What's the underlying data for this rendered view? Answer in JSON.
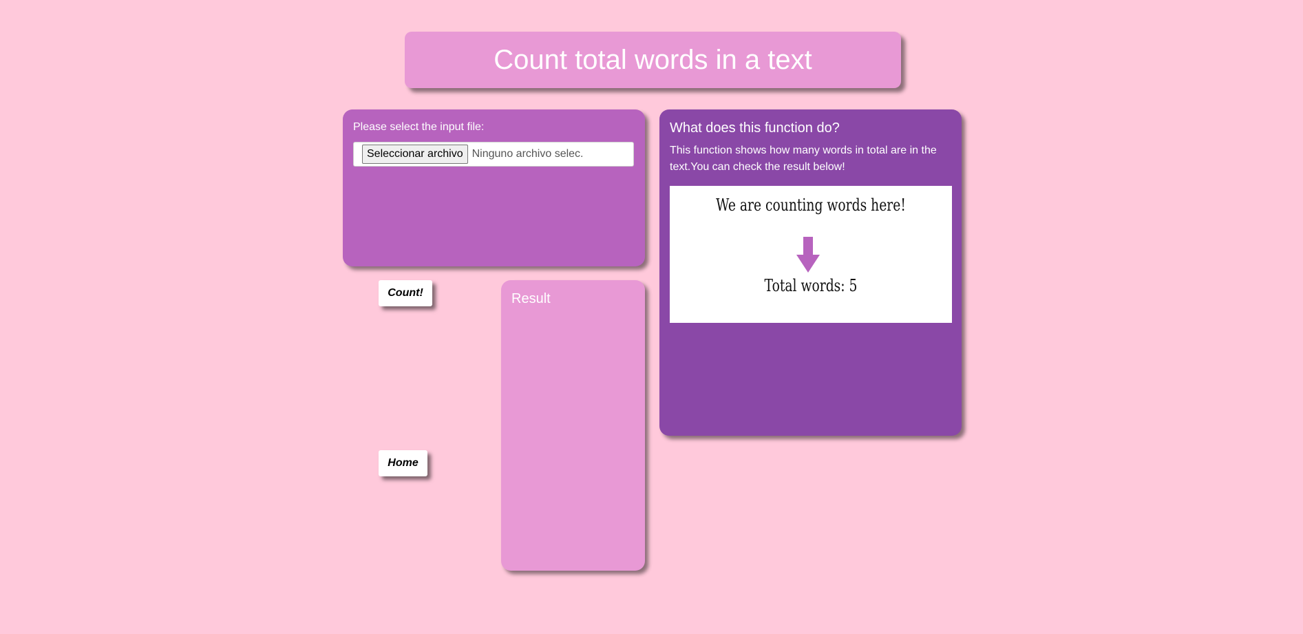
{
  "header": {
    "title": "Count total words in a text"
  },
  "input_panel": {
    "label": "Please select the input file:",
    "file_button_label": "Seleccionar archivo",
    "file_status": "Ninguno archivo selec."
  },
  "info_panel": {
    "title": "What does this function do?",
    "description": "This function shows how many words in total are in the text.You can check the result below!",
    "example": {
      "input_text": "We are counting words here!",
      "output_text": "Total words: 5",
      "arrow_icon": "arrow-down-icon",
      "arrow_color": "#b763be"
    }
  },
  "actions": {
    "count_label": "Count!",
    "home_label": "Home"
  },
  "result_panel": {
    "title": "Result"
  },
  "colors": {
    "background": "#ffc9db",
    "title_box": "#e899d5",
    "input_panel": "#b763be",
    "info_panel": "#8a48a7",
    "result_panel": "#e899d5"
  }
}
